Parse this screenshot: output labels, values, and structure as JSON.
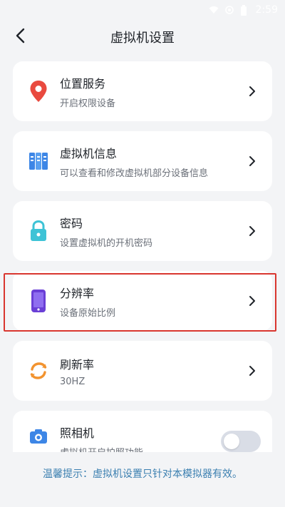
{
  "status_bar": {
    "time": "2:59"
  },
  "header": {
    "title": "虚拟机设置",
    "back_icon": "chevron-left-icon"
  },
  "settings": [
    {
      "title": "位置服务",
      "subtitle": "开启权限设备",
      "icon": "location-pin-icon",
      "color": "#e94a3f"
    },
    {
      "title": "虚拟机信息",
      "subtitle": "可以查看和修改虚拟机部分设备信息",
      "icon": "server-info-icon",
      "color": "#3d86e6"
    },
    {
      "title": "密码",
      "subtitle": "设置虚拟机的开机密码",
      "icon": "lock-icon",
      "color": "#3ec3d6"
    },
    {
      "title": "分辨率",
      "subtitle": "设备原始比例",
      "icon": "phone-icon",
      "color": "#6a3fd6"
    },
    {
      "title": "刷新率",
      "subtitle": "30HZ",
      "icon": "refresh-icon",
      "color": "#f2932f"
    },
    {
      "title": "照相机",
      "subtitle": "虚拟机开启拍照功能",
      "icon": "camera-icon",
      "color": "#3d86e6",
      "toggle_on": false
    }
  ],
  "footer": {
    "tip": "温馨提示：虚拟机设置只针对本模拟器有效。"
  },
  "colors": {
    "accent_tip": "#3b7fb0",
    "highlight_border": "#d9362f",
    "background": "#f3f4f6"
  }
}
